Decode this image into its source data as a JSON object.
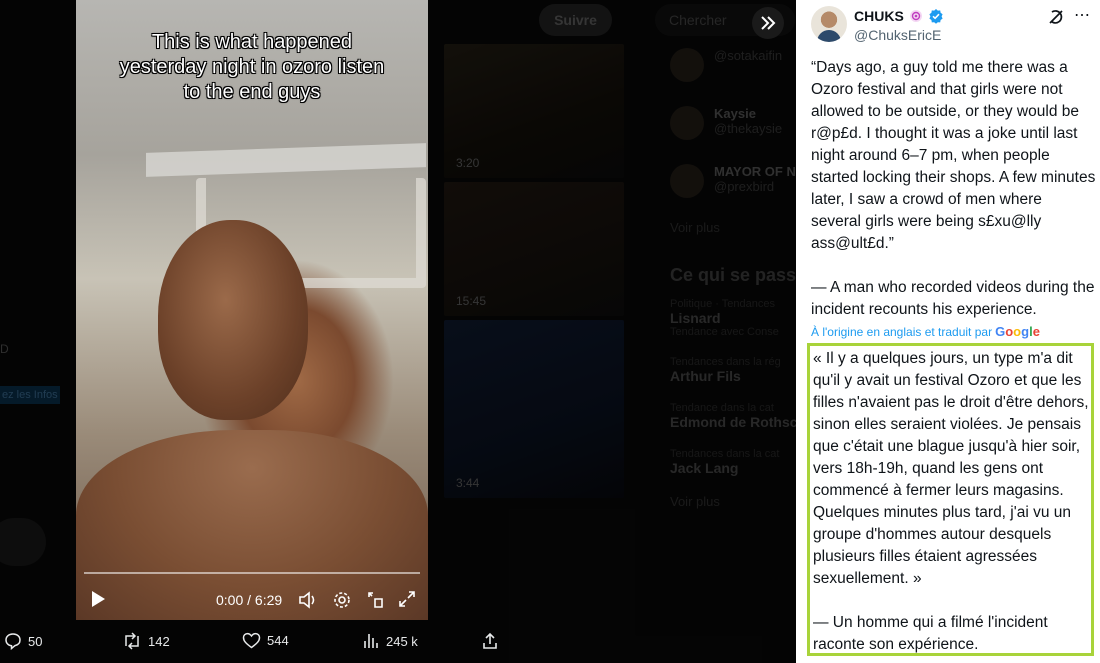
{
  "background": {
    "follow_label": "Suivre",
    "search_placeholder": "Chercher",
    "thumbnail_durations": [
      "3:20",
      "15:45",
      "3:44"
    ],
    "who_to_follow": [
      {
        "name": "",
        "handle": "@sotakaifin"
      },
      {
        "name": "Kaysie",
        "handle": "@thekaysie"
      },
      {
        "name": "MAYOR OF N",
        "handle": "@prexbird"
      }
    ],
    "see_more_label": "Voir plus",
    "trends_heading": "Ce qui se pass",
    "trends": [
      {
        "context": "Politique · Tendances",
        "title": "Lisnard",
        "sub": "Tendance avec Conse"
      },
      {
        "context": "Tendances dans la rég",
        "title": "Arthur Fils",
        "sub": ""
      },
      {
        "context": "Tendance dans la cat",
        "title": "Edmond de Rothsc",
        "sub": ""
      },
      {
        "context": "Tendances dans la cat",
        "title": "Jack Lang",
        "sub": ""
      }
    ],
    "trends_see_more": "Voir plus",
    "left_badge": "ez les Infos",
    "left_letter": "D"
  },
  "video": {
    "caption": "This is what happened yesterday night in ozoro listen to the end guys",
    "time": "0:00 / 6:29",
    "progress_fraction": 0
  },
  "engagement": {
    "replies": "50",
    "reposts": "142",
    "likes": "544",
    "views": "245 k"
  },
  "tweet": {
    "display_name": "CHUKS",
    "handle": "@ChuksEricE",
    "text": "“Days ago, a guy told me there was a Ozoro festival and that girls were not allowed to be outside, or they would be r@p£d. I thought it was a joke until last night around 6–7 pm, when people started locking their shops. A few minutes later, I saw a crowd of men where several girls were being s£xu@lly ass@ult£d.”\n\n— A man who recorded videos during the incident recounts his experience.",
    "attribution": "À l'origine en anglais et traduit par",
    "attribution_brand": "Google",
    "translation": "« Il y a quelques jours, un type m'a dit qu'il y avait un festival Ozoro et que les filles n'avaient pas le droit d'être dehors, sinon elles seraient violées. Je pensais que c'était une blague jusqu'à hier soir, vers 18h-19h, quand les gens ont commencé à fermer leurs magasins. Quelques minutes plus tard, j'ai vu un groupe d'hommes autour desquels plusieurs filles étaient agressées sexuellement. »\n\n— Un homme qui a filmé l'incident raconte son expérience."
  },
  "colors": {
    "verified_blue": "#1d9bf0",
    "highlight_border": "#a8d33a",
    "panel_bg": "#ffffff",
    "page_bg": "#000000"
  },
  "icons": [
    "expand-chevrons-icon",
    "play-icon",
    "volume-icon",
    "settings-icon",
    "exit-fullscreen-icon",
    "fullscreen-icon",
    "reply-icon",
    "repost-icon",
    "like-icon",
    "views-icon",
    "share-icon",
    "verified-icon",
    "badge-icon",
    "grok-icon",
    "more-icon"
  ]
}
